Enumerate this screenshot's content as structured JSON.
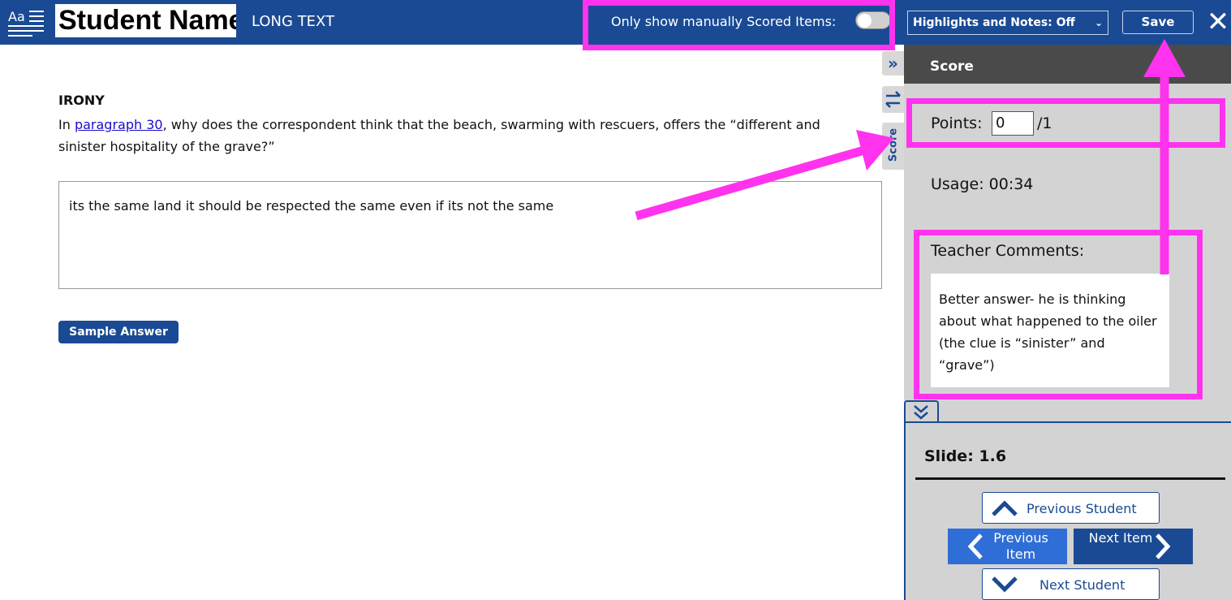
{
  "header": {
    "student_name": "Student Name",
    "item_type": "LONG TEXT",
    "manual_toggle_label": "Only show manually Scored Items:",
    "highlights_select": "Highlights and Notes: Off",
    "save_label": "Save",
    "close_symbol": "✕"
  },
  "question": {
    "title": "IRONY",
    "prefix": "In ",
    "link_text": "paragraph 30",
    "suffix": ", why does the correspondent think that the beach, swarming with rescuers, offers the “different and sinister hospitality of the grave?”",
    "answer": "its the same land it should be respected the same even if its not the same",
    "sample_button": "Sample Answer"
  },
  "side_tabs": {
    "score_tab": "Score"
  },
  "panel": {
    "heading": "Score",
    "points_label": "Points:",
    "points_value": "0",
    "points_max": "/1",
    "usage": "Usage: 00:34",
    "comments_label": "Teacher Comments:",
    "comments_text": "Better answer- he is thinking about what happened to the oiler (the clue is “sinister” and “grave”)"
  },
  "nav": {
    "slide": "Slide: 1.6",
    "previous_student": "Previous Student",
    "previous_item": "Previous Item",
    "next_item": "Next Item",
    "next_student": "Next Student"
  },
  "colors": {
    "brand": "#1a4a94",
    "annotation": "#ff33ee",
    "prev_item": "#2f6ed6"
  }
}
